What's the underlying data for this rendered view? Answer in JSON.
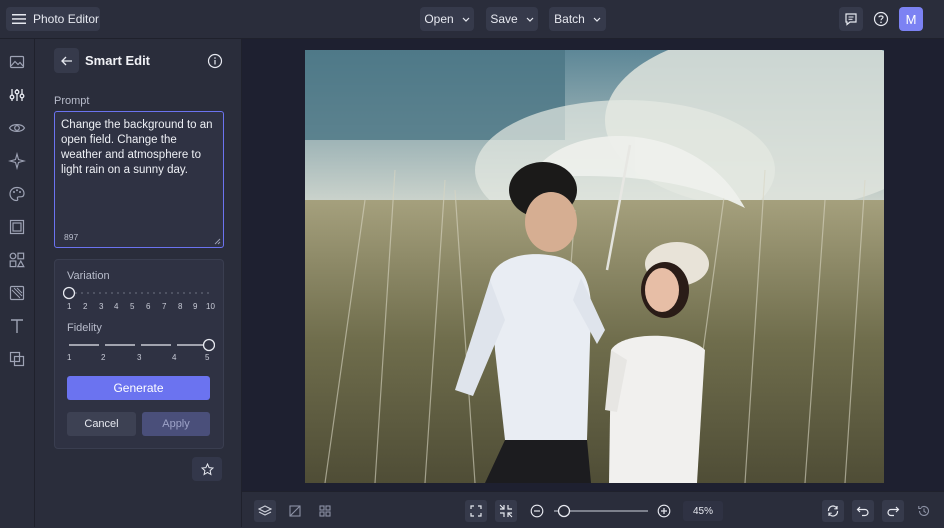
{
  "app": {
    "title": "Photo Editor",
    "avatar_letter": "M"
  },
  "menus": {
    "open": "Open",
    "save": "Save",
    "batch": "Batch"
  },
  "panel": {
    "title": "Smart Edit",
    "prompt_label": "Prompt",
    "prompt_text": "Change the background to an open field. Change the weather and atmosphere to light rain on a sunny day.",
    "char_count": "897",
    "variation": {
      "label": "Variation",
      "ticks": [
        "1",
        "2",
        "3",
        "4",
        "5",
        "6",
        "7",
        "8",
        "9",
        "10"
      ],
      "value": 1
    },
    "fidelity": {
      "label": "Fidelity",
      "ticks": [
        "1",
        "2",
        "3",
        "4",
        "5"
      ],
      "value": 5
    },
    "generate_label": "Generate",
    "cancel_label": "Cancel",
    "apply_label": "Apply"
  },
  "zoom": {
    "label": "45%",
    "value": 0.45
  },
  "colors": {
    "accent": "#6b73f0",
    "avatar": "#7c82f3",
    "panel_bg": "#2a2d3b",
    "canvas_bg": "#1e2030"
  }
}
